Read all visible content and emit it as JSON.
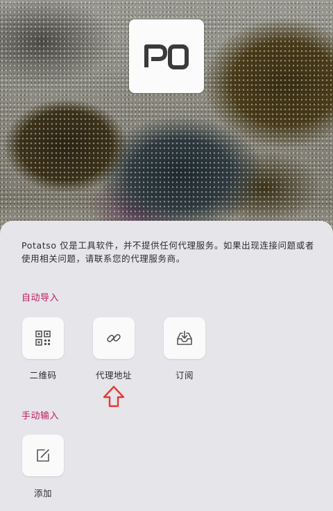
{
  "app": {
    "logo_text": "PO",
    "accent_color": "#c2185b"
  },
  "sheet": {
    "notice": "Potatso 仅是工具软件，并不提供任何代理服务。如果出现连接问题或者使用相关问题，请联系您的代理服务商。",
    "auto_import": {
      "title": "自动导入",
      "items": [
        {
          "label": "二维码",
          "icon": "qr-code-icon"
        },
        {
          "label": "代理地址",
          "icon": "link-icon"
        },
        {
          "label": "订阅",
          "icon": "subscribe-download-icon"
        }
      ]
    },
    "manual_input": {
      "title": "手动输入",
      "items": [
        {
          "label": "添加",
          "icon": "edit-icon"
        }
      ]
    }
  },
  "annotation": {
    "arrow_icon": "up-arrow-icon",
    "arrow_color": "#e53935"
  }
}
